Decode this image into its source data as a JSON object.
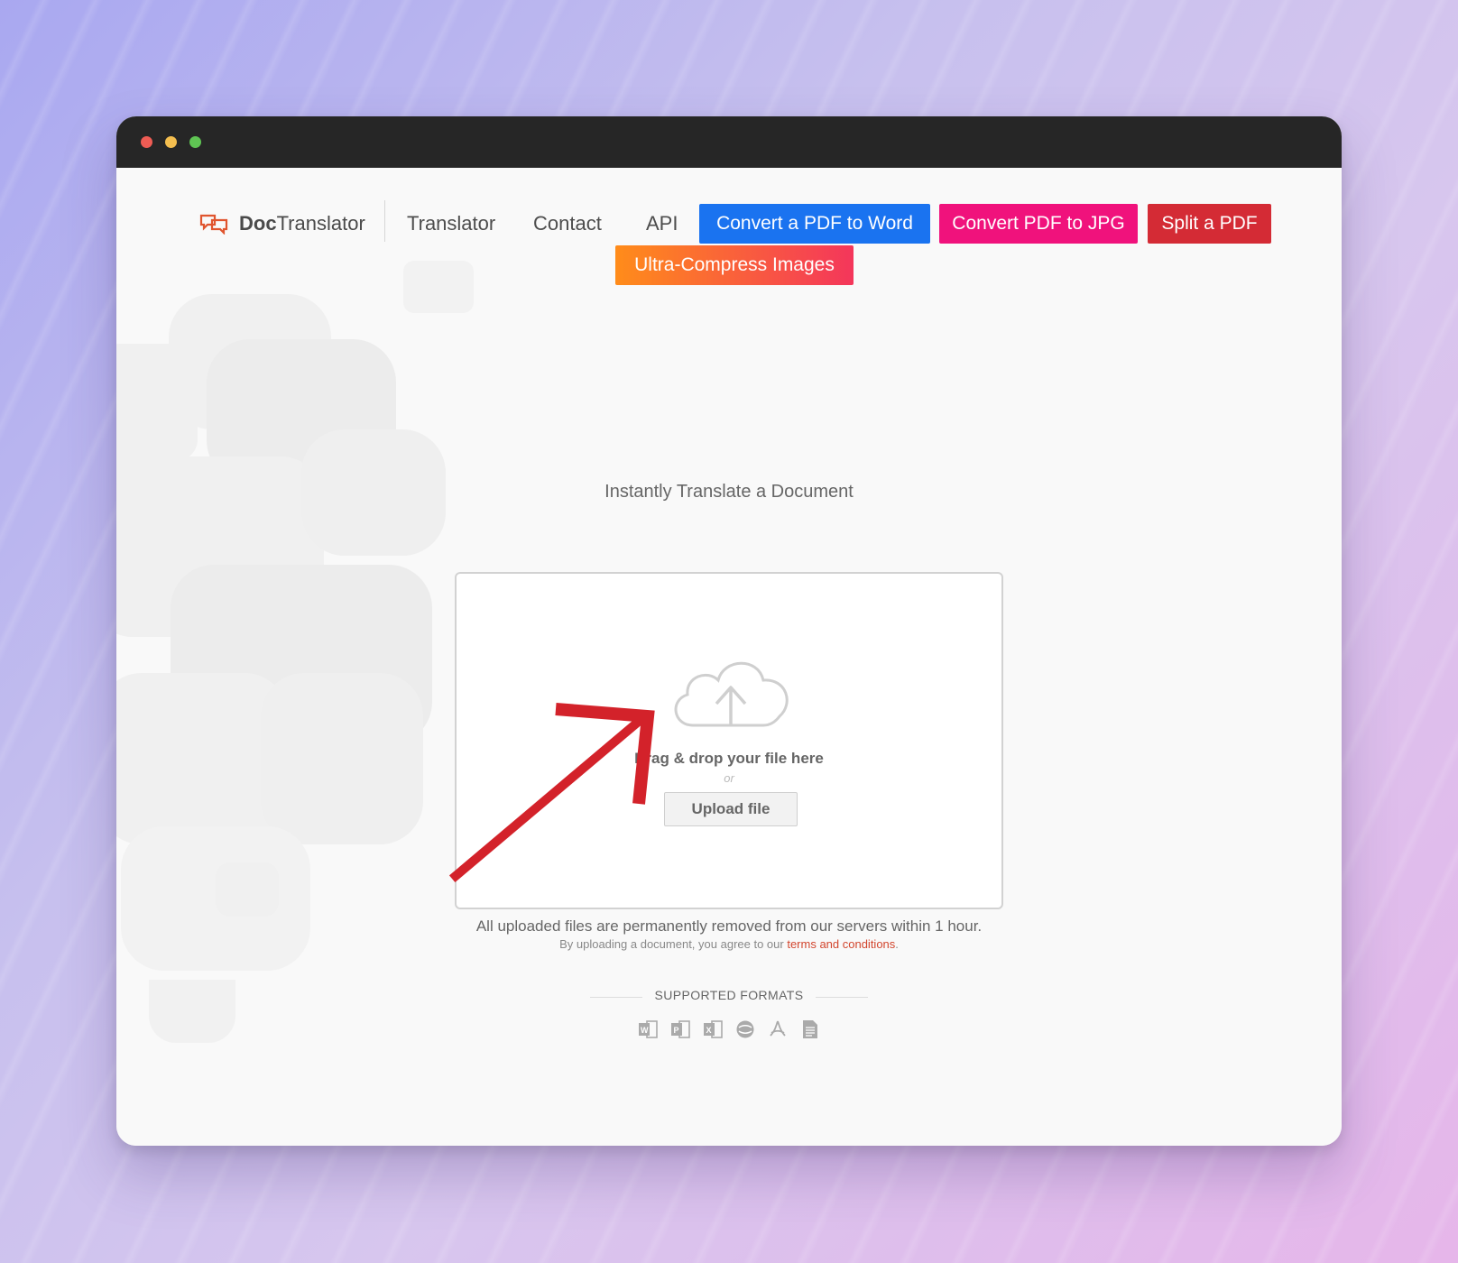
{
  "brand": {
    "name_bold": "Doc",
    "name_rest": "Translator"
  },
  "nav": {
    "translator": "Translator",
    "contact": "Contact",
    "api": "API",
    "convert_word": "Convert a PDF to Word",
    "convert_jpg": "Convert PDF to JPG",
    "split_pdf": "Split a PDF",
    "compress": "Ultra-Compress Images"
  },
  "colors": {
    "convert_word": "#1a73f0",
    "convert_jpg": "#f0127c",
    "split_pdf": "#d42b35",
    "compress_from": "#ff8c1a",
    "compress_to": "#f4365b",
    "brand_accent": "#e0552f",
    "annotation_arrow": "#d3222a"
  },
  "page": {
    "subtitle": "Instantly Translate a Document"
  },
  "upload": {
    "drag_text": "Drag & drop your file here",
    "or_text": "or",
    "button_label": "Upload file",
    "notice": "All uploaded files are permanently removed from our servers within 1 hour.",
    "terms_prefix": "By uploading a document, you agree to our ",
    "terms_link": "terms and conditions",
    "terms_suffix": "."
  },
  "formats": {
    "label": "SUPPORTED FORMATS",
    "icons": [
      "word-icon",
      "powerpoint-icon",
      "excel-icon",
      "opendocument-icon",
      "pdf-icon",
      "text-file-icon"
    ]
  }
}
